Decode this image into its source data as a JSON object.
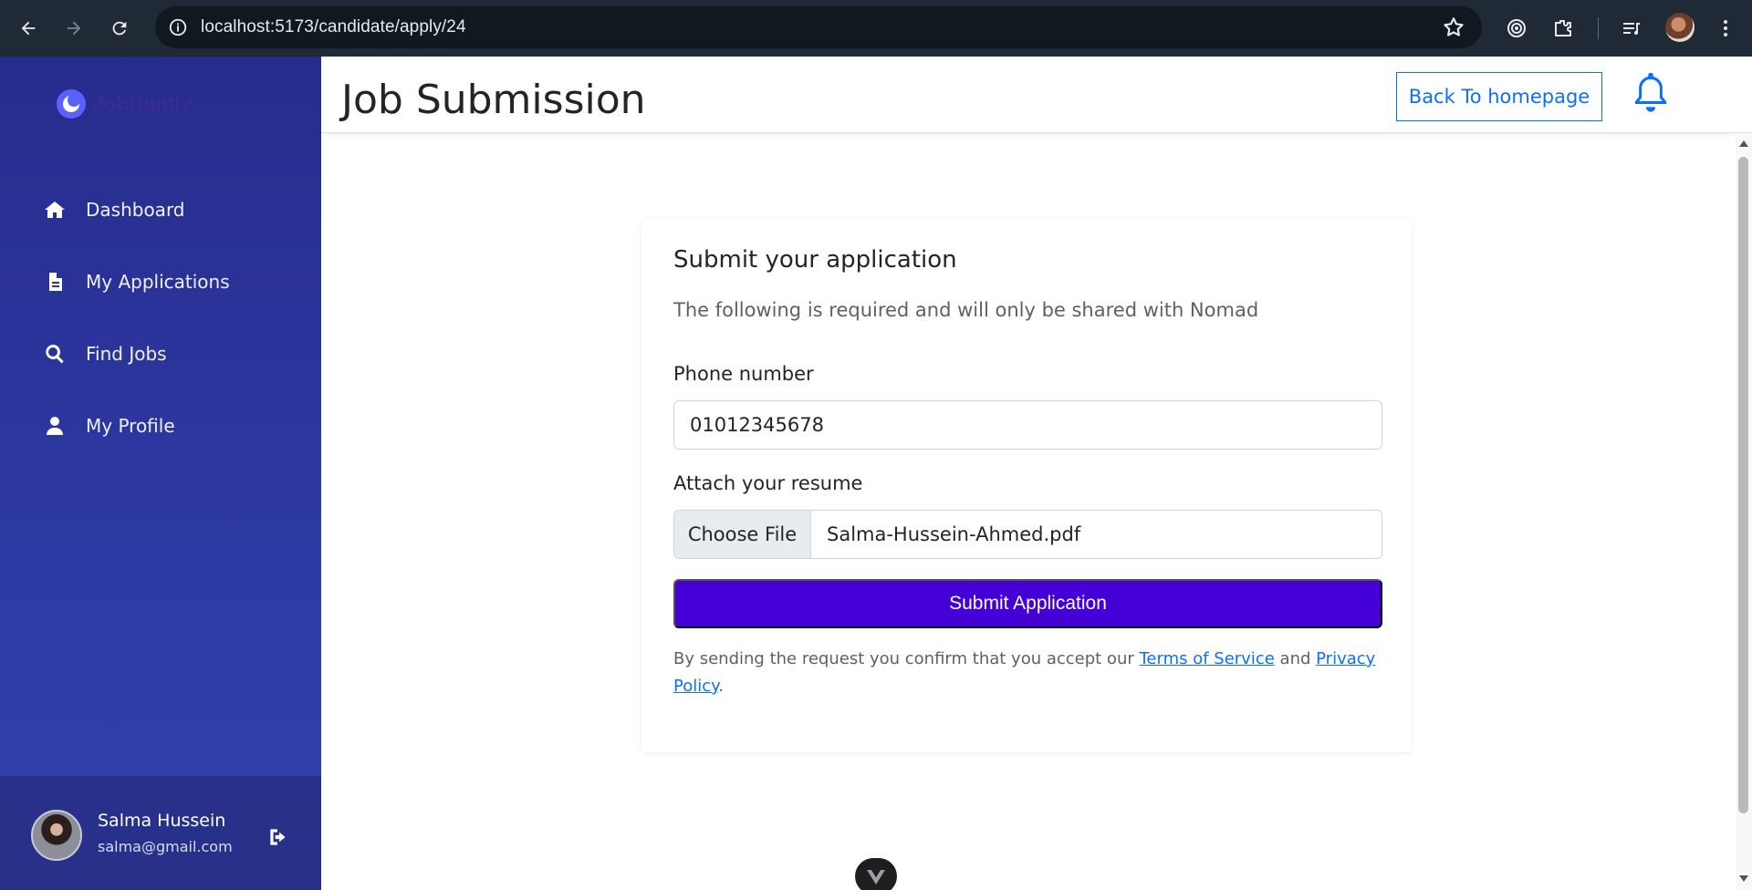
{
  "browser": {
    "url": "localhost:5173/candidate/apply/24"
  },
  "brand": {
    "name": "JobHuntly"
  },
  "sidebar": {
    "items": [
      {
        "label": "Dashboard",
        "icon": "home-icon"
      },
      {
        "label": "My Applications",
        "icon": "file-icon"
      },
      {
        "label": "Find Jobs",
        "icon": "search-icon"
      },
      {
        "label": "My Profile",
        "icon": "user-icon"
      }
    ],
    "user": {
      "name": "Salma Hussein",
      "email": "salma@gmail.com"
    }
  },
  "header": {
    "title": "Job Submission",
    "back_label": "Back To homepage"
  },
  "form": {
    "title": "Submit your application",
    "subtitle": "The following is required and will only be shared with Nomad",
    "phone_label": "Phone number",
    "phone_value": "01012345678",
    "resume_label": "Attach your resume",
    "choose_file_label": "Choose File",
    "file_name": "Salma-Hussein-Ahmed.pdf",
    "submit_label": "Submit Application",
    "terms_prefix": "By sending the request you confirm that you accept our ",
    "terms_link": "Terms of Service",
    "terms_and": " and ",
    "privacy_link": "Privacy Policy",
    "terms_suffix": "."
  },
  "colors": {
    "sidebar": "#2e3aa5",
    "accent": "#0d6efd",
    "submit": "#4400d6"
  }
}
